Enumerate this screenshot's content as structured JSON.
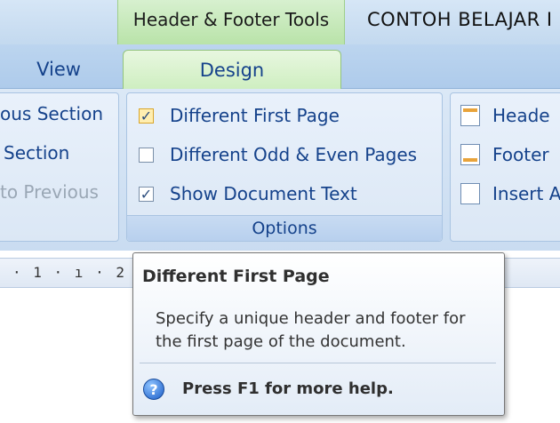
{
  "titlebar": {
    "context_group": "Header & Footer Tools",
    "document_title": "CONTOH BELAJAR I"
  },
  "tabs": {
    "view": "View",
    "design": "Design"
  },
  "navigation": {
    "previous_section": "ous Section",
    "next_section": "Section",
    "link_to_previous": "to Previous"
  },
  "options": {
    "items": [
      {
        "label": "Different First Page",
        "checked": true
      },
      {
        "label": "Different Odd & Even Pages",
        "checked": false
      },
      {
        "label": "Show Document Text",
        "checked": true
      }
    ],
    "group_label": "Options"
  },
  "position": {
    "header_from_top": "Heade",
    "footer_from_bottom": "Footer",
    "insert_alignment_tab": "Insert A"
  },
  "ruler": {
    "text": "· 1 · ı · 2 · ı"
  },
  "tooltip": {
    "title": "Different First Page",
    "body": "Specify a unique header and footer for the first page of the document.",
    "help": "Press F1 for more help."
  },
  "colors": {
    "accent": "#15428b",
    "context_green": "#b9e3a9",
    "ribbon_blue": "#c9dcf1"
  }
}
